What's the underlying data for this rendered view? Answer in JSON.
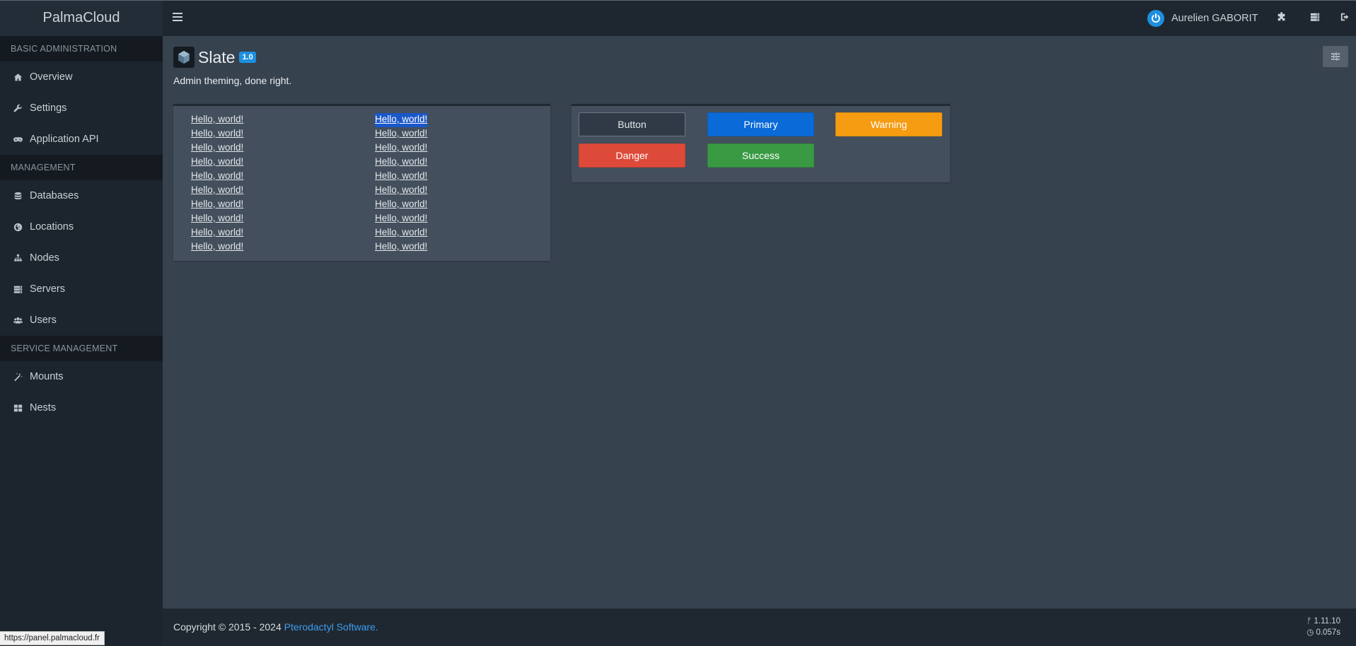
{
  "app": {
    "brand": "PalmaCloud"
  },
  "sidebar": {
    "sections": [
      {
        "header": "BASIC ADMINISTRATION",
        "items": [
          {
            "label": "Overview",
            "icon": "home-icon"
          },
          {
            "label": "Settings",
            "icon": "wrench-icon"
          },
          {
            "label": "Application API",
            "icon": "gamepad-icon"
          }
        ]
      },
      {
        "header": "MANAGEMENT",
        "items": [
          {
            "label": "Databases",
            "icon": "database-icon"
          },
          {
            "label": "Locations",
            "icon": "globe-icon"
          },
          {
            "label": "Nodes",
            "icon": "sitemap-icon"
          },
          {
            "label": "Servers",
            "icon": "server-icon"
          },
          {
            "label": "Users",
            "icon": "users-icon"
          }
        ]
      },
      {
        "header": "SERVICE MANAGEMENT",
        "items": [
          {
            "label": "Mounts",
            "icon": "magic-wand-icon"
          },
          {
            "label": "Nests",
            "icon": "grid-icon"
          }
        ]
      }
    ]
  },
  "header": {
    "user_name": "Aurelien GABORIT",
    "icons": [
      "puzzle-icon",
      "server-list-icon",
      "sign-out-icon"
    ]
  },
  "page": {
    "title": "Slate",
    "version": "1.0",
    "subtitle": "Admin theming, done right."
  },
  "links": {
    "left": [
      "Hello, world!",
      "Hello, world!",
      "Hello, world!",
      "Hello, world!",
      "Hello, world!",
      "Hello, world!",
      "Hello, world!",
      "Hello, world!",
      "Hello, world!",
      "Hello, world!"
    ],
    "right": [
      "Hello, world!",
      "Hello, world!",
      "Hello, world!",
      "Hello, world!",
      "Hello, world!",
      "Hello, world!",
      "Hello, world!",
      "Hello, world!",
      "Hello, world!",
      "Hello, world!"
    ]
  },
  "buttons": {
    "default": "Button",
    "primary": "Primary",
    "warning": "Warning",
    "danger": "Danger",
    "success": "Success"
  },
  "footer": {
    "copyright_prefix": "Copyright © 2015 - 2024 ",
    "copyright_link": "Pterodactyl Software.",
    "version": "1.11.10",
    "render_time": "0.057s"
  },
  "status_bar": {
    "url": "https://panel.palmacloud.fr"
  },
  "colors": {
    "accent": "#1d8fe0",
    "primary": "#0a6ad8",
    "warning": "#f59c12",
    "danger": "#de4a3a",
    "success": "#3a9a44"
  }
}
